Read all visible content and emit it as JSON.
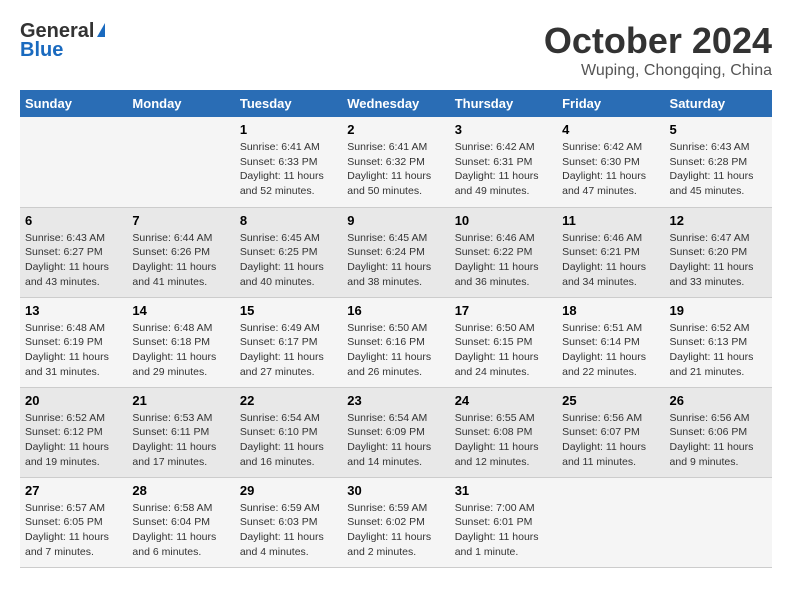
{
  "header": {
    "logo_general": "General",
    "logo_blue": "Blue",
    "month_title": "October 2024",
    "location": "Wuping, Chongqing, China"
  },
  "calendar": {
    "days_of_week": [
      "Sunday",
      "Monday",
      "Tuesday",
      "Wednesday",
      "Thursday",
      "Friday",
      "Saturday"
    ],
    "weeks": [
      [
        {
          "day": "",
          "detail": ""
        },
        {
          "day": "",
          "detail": ""
        },
        {
          "day": "1",
          "detail": "Sunrise: 6:41 AM\nSunset: 6:33 PM\nDaylight: 11 hours and 52 minutes."
        },
        {
          "day": "2",
          "detail": "Sunrise: 6:41 AM\nSunset: 6:32 PM\nDaylight: 11 hours and 50 minutes."
        },
        {
          "day": "3",
          "detail": "Sunrise: 6:42 AM\nSunset: 6:31 PM\nDaylight: 11 hours and 49 minutes."
        },
        {
          "day": "4",
          "detail": "Sunrise: 6:42 AM\nSunset: 6:30 PM\nDaylight: 11 hours and 47 minutes."
        },
        {
          "day": "5",
          "detail": "Sunrise: 6:43 AM\nSunset: 6:28 PM\nDaylight: 11 hours and 45 minutes."
        }
      ],
      [
        {
          "day": "6",
          "detail": "Sunrise: 6:43 AM\nSunset: 6:27 PM\nDaylight: 11 hours and 43 minutes."
        },
        {
          "day": "7",
          "detail": "Sunrise: 6:44 AM\nSunset: 6:26 PM\nDaylight: 11 hours and 41 minutes."
        },
        {
          "day": "8",
          "detail": "Sunrise: 6:45 AM\nSunset: 6:25 PM\nDaylight: 11 hours and 40 minutes."
        },
        {
          "day": "9",
          "detail": "Sunrise: 6:45 AM\nSunset: 6:24 PM\nDaylight: 11 hours and 38 minutes."
        },
        {
          "day": "10",
          "detail": "Sunrise: 6:46 AM\nSunset: 6:22 PM\nDaylight: 11 hours and 36 minutes."
        },
        {
          "day": "11",
          "detail": "Sunrise: 6:46 AM\nSunset: 6:21 PM\nDaylight: 11 hours and 34 minutes."
        },
        {
          "day": "12",
          "detail": "Sunrise: 6:47 AM\nSunset: 6:20 PM\nDaylight: 11 hours and 33 minutes."
        }
      ],
      [
        {
          "day": "13",
          "detail": "Sunrise: 6:48 AM\nSunset: 6:19 PM\nDaylight: 11 hours and 31 minutes."
        },
        {
          "day": "14",
          "detail": "Sunrise: 6:48 AM\nSunset: 6:18 PM\nDaylight: 11 hours and 29 minutes."
        },
        {
          "day": "15",
          "detail": "Sunrise: 6:49 AM\nSunset: 6:17 PM\nDaylight: 11 hours and 27 minutes."
        },
        {
          "day": "16",
          "detail": "Sunrise: 6:50 AM\nSunset: 6:16 PM\nDaylight: 11 hours and 26 minutes."
        },
        {
          "day": "17",
          "detail": "Sunrise: 6:50 AM\nSunset: 6:15 PM\nDaylight: 11 hours and 24 minutes."
        },
        {
          "day": "18",
          "detail": "Sunrise: 6:51 AM\nSunset: 6:14 PM\nDaylight: 11 hours and 22 minutes."
        },
        {
          "day": "19",
          "detail": "Sunrise: 6:52 AM\nSunset: 6:13 PM\nDaylight: 11 hours and 21 minutes."
        }
      ],
      [
        {
          "day": "20",
          "detail": "Sunrise: 6:52 AM\nSunset: 6:12 PM\nDaylight: 11 hours and 19 minutes."
        },
        {
          "day": "21",
          "detail": "Sunrise: 6:53 AM\nSunset: 6:11 PM\nDaylight: 11 hours and 17 minutes."
        },
        {
          "day": "22",
          "detail": "Sunrise: 6:54 AM\nSunset: 6:10 PM\nDaylight: 11 hours and 16 minutes."
        },
        {
          "day": "23",
          "detail": "Sunrise: 6:54 AM\nSunset: 6:09 PM\nDaylight: 11 hours and 14 minutes."
        },
        {
          "day": "24",
          "detail": "Sunrise: 6:55 AM\nSunset: 6:08 PM\nDaylight: 11 hours and 12 minutes."
        },
        {
          "day": "25",
          "detail": "Sunrise: 6:56 AM\nSunset: 6:07 PM\nDaylight: 11 hours and 11 minutes."
        },
        {
          "day": "26",
          "detail": "Sunrise: 6:56 AM\nSunset: 6:06 PM\nDaylight: 11 hours and 9 minutes."
        }
      ],
      [
        {
          "day": "27",
          "detail": "Sunrise: 6:57 AM\nSunset: 6:05 PM\nDaylight: 11 hours and 7 minutes."
        },
        {
          "day": "28",
          "detail": "Sunrise: 6:58 AM\nSunset: 6:04 PM\nDaylight: 11 hours and 6 minutes."
        },
        {
          "day": "29",
          "detail": "Sunrise: 6:59 AM\nSunset: 6:03 PM\nDaylight: 11 hours and 4 minutes."
        },
        {
          "day": "30",
          "detail": "Sunrise: 6:59 AM\nSunset: 6:02 PM\nDaylight: 11 hours and 2 minutes."
        },
        {
          "day": "31",
          "detail": "Sunrise: 7:00 AM\nSunset: 6:01 PM\nDaylight: 11 hours and 1 minute."
        },
        {
          "day": "",
          "detail": ""
        },
        {
          "day": "",
          "detail": ""
        }
      ]
    ]
  }
}
